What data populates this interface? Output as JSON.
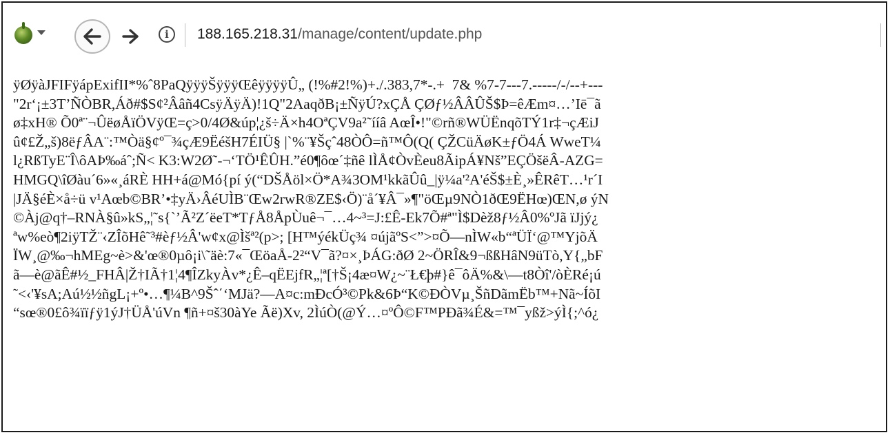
{
  "browser": {
    "icon": "onion-browser-icon",
    "menu_icon": "chevron-down-icon",
    "back_icon": "back-arrow-icon",
    "forward_icon": "forward-arrow-icon",
    "info_icon": "info-icon",
    "info_glyph": "i",
    "url_host": "188.165.218.31",
    "url_path": "/manage/content/update.php"
  },
  "content": {
    "lines": [
      "ÿØÿàJFIFÿápExifII*%ˆ8PaQÿÿÿŠÿÿÿŒêÿÿÿÿÛ„ (!%#2!%)+./.383,7*-.+  7& %7-7---7.-----/-/--+---",
      "\"2r‘¡±3T’ÑÒBR,Áð#$S¢²Ââñ4CsÿÄÿÄ)!1Q\"2AaqðB¡±ÑÿÚ?xÇÅ ÇØƒ½ÂÂÛŠ$Þ=êÆm¤…’Iē¯ã",
      "ø‡xH® Õ0ª¨¬ÛëøÅïÖVÿŒ=ç>0/4Ø&úp¦¿š÷Ä×h4OªÇV9a²˜ííâ AœÎ•!\"©rñ®WÜËnqõTÝ1r‡¬çÆiJ",
      "û¢£Ž„š)8ëƒÂA¨:™Òä§¢º¯¾çÆ9ËéšH7ÉIÜ§ |`%¨¥Šçˆ48ÒÔ=ñ™Ô(Q( ÇŽCüÄøK±ƒÖ4Á WweT¼",
      "l¿RßTyE¨Î\\ôAÞ‰áˆ;Ñ< K3:W2Ø˜-¬‘TÖ¹ÊÛH.”é0¶ôœ´‡ñê lÌÅ¢ÒvÈeu8ÃipÁ¥Nš”EÇÖšëÂ-AZG=",
      "HMGQ\\îØàu´6»«¸áRÈ HH+á@Mó{pí ý(“DŠÅöl×Ö*A¾3OM¹kkãÛû_|ÿ¼a'²A'éŠ$±È¸»ÊRêT…¹r´I",
      "|JÄ§éÈ×å÷ü v¹Aœb©BR’•‡yÄ›ÂéUÌB¨Œw2rwR®ZE$‹Ö)¨å´¥Â¯»¶\"öŒµ9NÒ1ðŒ9ËHœ)ŒN,ø ýN",
      "©Àj@q†–RNÀ§û»kS„¦˜s{`’Ã²Z´ëeT*TƒÅ8ÅpÙuê¬¯…4~³=J:£Ê-Ek7Õ#ª\"Ì$Dèž8ƒ½Â0%ºJã ïJjý¿",
      "ªw%eò¶2iÿTŽ¨‹ZÎõHê˜³#èƒ½Â'w¢x@Ìšª²(p>; [H™ýékÜç¾ ¤újãºS<”>¤Õ—nÌW«b“ªÜÏ‘@™YjõÄ",
      "ÏW¸@‰¬hMEg~è>&'œ®0µô¡i\\˜äè:7«¯ŒöaÅ-2²“V¯ã?¤×¸ÞÁG:ðØ 2~ÖRÎ&9¬ßßHâN9üTò,Y{„bF",
      "ã—è@ãÊ#½_FHÂ|Ž†IÃ†1¦4¶ÎZkyÀv*¿Ê–qËEjfR„¦ª[†Š¡4æ¤W¿~¨Ł€þ#}ê¯ôÄ%&\\—t8Òî'/òÈRé¡ú",
      "˜<‹'¥sA;Aú½½ñgL¡+º•…¶¼B^9Šˆ΄‘MJä?—A¤c:mÐcÓ³©Pk&6Þ“K©ÐÒVµ¸ŠñDãmËb™+Nã~ÍõI",
      "“sœ®0£ô¾ïïƒÿ1ýJ†ÜÅ'úVn ¶ñ+¤š30àYe Ãë)Xv, 2ÌúÒ(@Ý…¤ºÔ©F™PÐã¾É&=™¯yßž>ýÌ{;^ó¿"
    ]
  }
}
